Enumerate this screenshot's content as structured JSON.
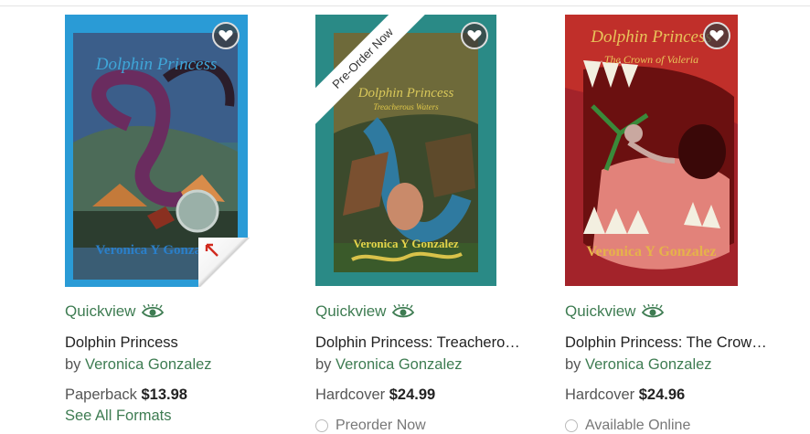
{
  "products": [
    {
      "cover_title": "Dolphin Princess",
      "cover_author": "Veronica Y Gonzalez",
      "quickview_label": "Quickview",
      "title": "Dolphin Princess",
      "by_label": "by",
      "author": "Veronica Gonzalez",
      "format": "Paperback",
      "price": "$13.98",
      "see_all_formats": "See All Formats",
      "colors": {
        "frame": "#2a9bd6"
      }
    },
    {
      "cover_title": "Dolphin Princess",
      "cover_subtitle": "Treacherous Waters",
      "cover_author": "Veronica Y Gonzalez",
      "ribbon": "Pre-Order Now",
      "quickview_label": "Quickview",
      "title": "Dolphin Princess: Treachero…",
      "by_label": "by",
      "author": "Veronica Gonzalez",
      "format": "Hardcover",
      "price": "$24.99",
      "availability": "Preorder Now",
      "colors": {
        "frame": "#2a8a86"
      }
    },
    {
      "cover_title": "Dolphin Princess",
      "cover_subtitle": "The Crown of Valeria",
      "cover_author": "Veronica Y Gonzalez",
      "quickview_label": "Quickview",
      "title": "Dolphin Princess: The Crow…",
      "by_label": "by",
      "author": "Veronica Gonzalez",
      "format": "Hardcover",
      "price": "$24.96",
      "availability": "Available Online",
      "colors": {
        "frame": "#8f1a20"
      }
    }
  ],
  "colors": {
    "link": "#3e7c52",
    "text": "#222222"
  }
}
